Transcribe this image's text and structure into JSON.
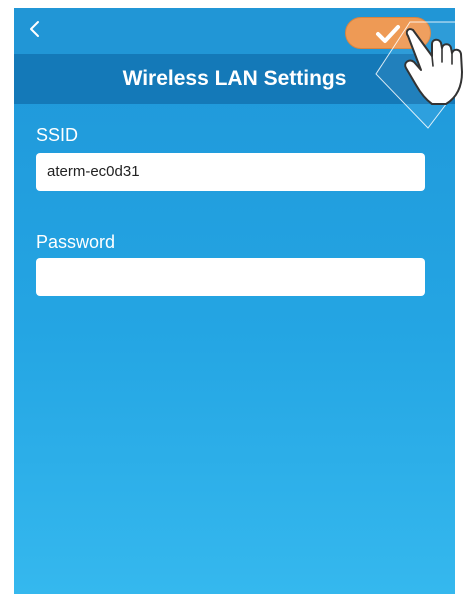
{
  "header": {
    "back_icon": "chevron-left-icon",
    "confirm_icon": "checkmark-icon",
    "title": "Wireless LAN Settings"
  },
  "form": {
    "ssid_label": "SSID",
    "ssid_value": "aterm-ec0d31",
    "password_label": "Password",
    "password_value": ""
  },
  "colors": {
    "nav_bar": "#1479b8",
    "background": "#24a5e3",
    "confirm_button": "#ee9a55"
  }
}
